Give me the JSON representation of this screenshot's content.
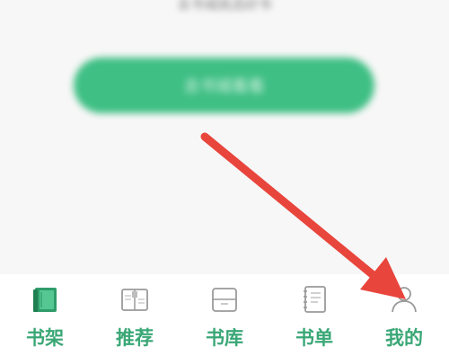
{
  "main": {
    "empty_hint_line1": "",
    "empty_hint_line2": "去书城挑选好书",
    "cta_label": "去书城看看"
  },
  "tabbar": {
    "tabs": [
      {
        "label": "书架",
        "icon": "bookshelf-icon",
        "active": true
      },
      {
        "label": "推荐",
        "icon": "open-book-icon",
        "active": false
      },
      {
        "label": "书库",
        "icon": "library-icon",
        "active": false
      },
      {
        "label": "书单",
        "icon": "notebook-icon",
        "active": false
      },
      {
        "label": "我的",
        "icon": "user-icon",
        "active": false
      }
    ]
  },
  "annotation": {
    "arrow_color": "#e8453c"
  },
  "colors": {
    "accent": "#3aa776",
    "cta": "#3fbf84",
    "icon_gray": "#9a9a9a"
  }
}
